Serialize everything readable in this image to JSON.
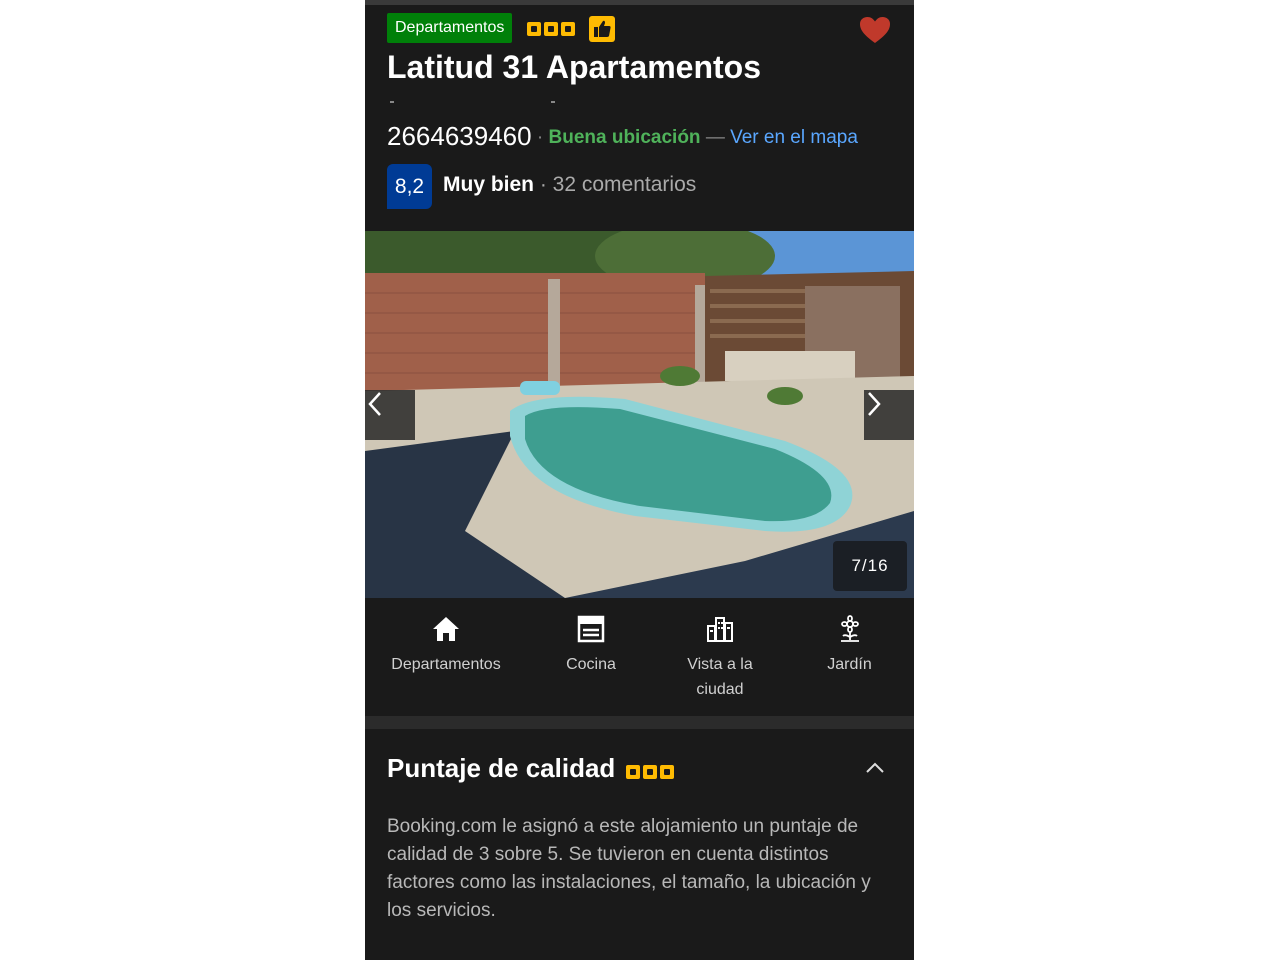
{
  "property": {
    "type_badge": "Departamentos",
    "quality_squares": 3,
    "name": "Latitud 31 Apartamentos",
    "phone": "2664639460",
    "location_label": "Buena ubicación",
    "separator": "—",
    "map_link": "Ver en el mapa",
    "favorite": true
  },
  "rating": {
    "score": "8,2",
    "word": "Muy bien",
    "reviews": "· 32 comentarios"
  },
  "gallery": {
    "counter": "7/16",
    "current": 7,
    "total": 16
  },
  "facilities": [
    {
      "label": "Departamentos",
      "icon": "house-icon"
    },
    {
      "label": "Cocina",
      "icon": "oven-icon"
    },
    {
      "label": "Vista a la ciudad",
      "icon": "city-icon"
    },
    {
      "label": "Jardín",
      "icon": "flower-icon"
    }
  ],
  "quality_section": {
    "title": "Puntaje de calidad",
    "body": "Booking.com le asignó a este alojamiento un puntaje de calidad de 3 sobre 5. Se tuvieron en cuenta distintos factores como las instalaciones, el tamaño, la ubicación y los servicios.",
    "expanded": true
  },
  "colors": {
    "background": "#1a1a1a",
    "type_badge": "#008009",
    "squares": "#febb02",
    "score_box": "#003b95",
    "location": "#4fb25a",
    "link": "#5aa7ff",
    "heart": "#c0392b"
  }
}
